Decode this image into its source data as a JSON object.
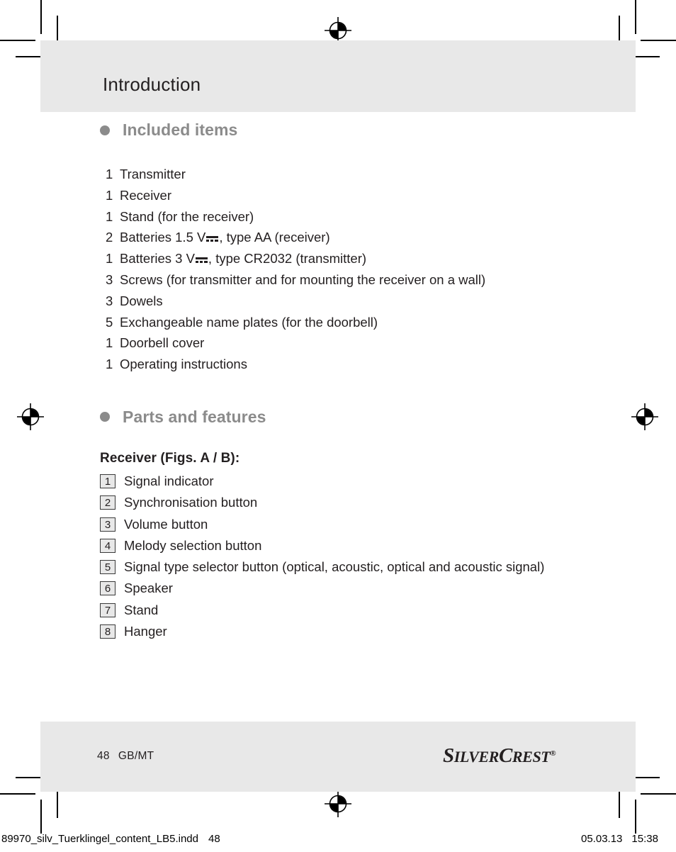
{
  "page": {
    "header_title": "Introduction",
    "footer": {
      "page_number": "48",
      "locale": "GB/MT",
      "logo": {
        "part1_cap": "S",
        "part1_rest": "ILVER",
        "part2_cap": "C",
        "part2_rest": "REST",
        "registered": "®"
      }
    }
  },
  "sections": {
    "included_items": {
      "heading": "Included items",
      "items": [
        {
          "qty": "1",
          "text": "Transmitter"
        },
        {
          "qty": "1",
          "text": "Receiver"
        },
        {
          "qty": "1",
          "text": "Stand (for the receiver)"
        },
        {
          "qty": "2",
          "text_before": "Batteries  1.5 V",
          "has_dc": true,
          "text_after": ", type AA (receiver)"
        },
        {
          "qty": "1",
          "text_before": "Batteries 3 V",
          "has_dc": true,
          "text_after": ", type CR2032 (transmitter)"
        },
        {
          "qty": "3",
          "text": "Screws (for transmitter and for mounting the receiver on a wall)"
        },
        {
          "qty": "3",
          "text": "Dowels"
        },
        {
          "qty": "5",
          "text": "Exchangeable name plates (for the doorbell)"
        },
        {
          "qty": "1",
          "text": "Doorbell cover"
        },
        {
          "qty": "1",
          "text": "Operating instructions"
        }
      ]
    },
    "parts_and_features": {
      "heading": "Parts and features",
      "subheading": "Receiver (Figs. A / B):",
      "parts": [
        {
          "num": "1",
          "label": "Signal indicator"
        },
        {
          "num": "2",
          "label": "Synchronisation button"
        },
        {
          "num": "3",
          "label": "Volume button"
        },
        {
          "num": "4",
          "label": "Melody selection button"
        },
        {
          "num": "5",
          "label": "Signal type selector button (optical, acoustic, optical and acoustic signal)"
        },
        {
          "num": "6",
          "label": "Speaker"
        },
        {
          "num": "7",
          "label": "Stand"
        },
        {
          "num": "8",
          "label": "Hanger"
        }
      ]
    }
  },
  "print_info": {
    "filename": "89970_silv_Tuerklingel_content_LB5.indd",
    "page": "48",
    "date": "05.03.13",
    "time": "15:38"
  },
  "colors": {
    "band_gray": "#e8e8e8",
    "heading_gray": "#8b8b8b",
    "text_black": "#231f20"
  }
}
